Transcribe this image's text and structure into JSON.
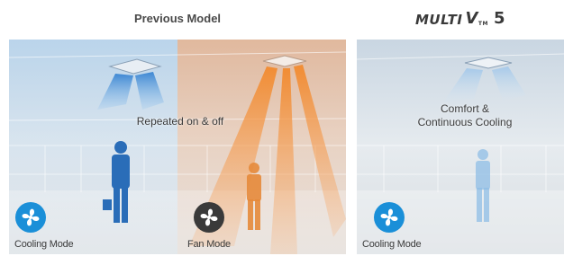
{
  "header": {
    "left_title": "Previous Model",
    "logo": {
      "name": "MULTI",
      "v": "V",
      "tm": "TM",
      "version": "5"
    }
  },
  "left_panel": {
    "center_text": "Repeated on & off",
    "modes": [
      {
        "label": "Cooling Mode",
        "icon": "cooling-fan-icon",
        "color": "#1a8fd8"
      },
      {
        "label": "Fan Mode",
        "icon": "fan-icon",
        "color": "#3a3a3a"
      }
    ]
  },
  "right_panel": {
    "center_text_line1": "Comfort &",
    "center_text_line2": "Continuous Cooling",
    "mode": {
      "label": "Cooling Mode",
      "icon": "cooling-fan-icon",
      "color": "#1a8fd8"
    }
  },
  "colors": {
    "cool_blue": "#1a8fd8",
    "warm_orange": "#f08a3a",
    "room_gray": "#dfe3e6"
  }
}
